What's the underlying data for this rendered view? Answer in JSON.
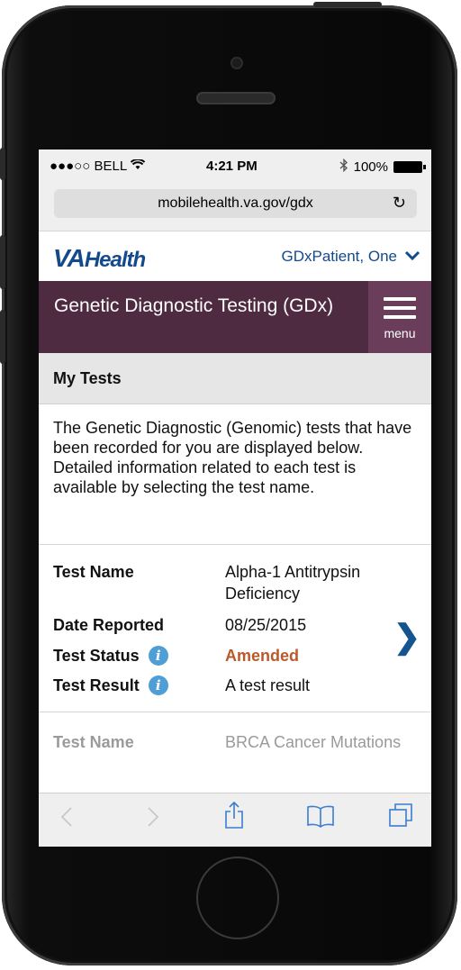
{
  "status": {
    "carrier": "●●●○○ BELL",
    "wifi_icon": "wifi-icon",
    "time": "4:21 PM",
    "bluetooth_icon": "bluetooth-icon",
    "battery_percent": "100%"
  },
  "browser": {
    "url": "mobilehealth.va.gov/gdx",
    "reload_icon": "reload-icon"
  },
  "header": {
    "logo_va": "VA",
    "logo_health": "Health",
    "user_name": "GDxPatient, One",
    "user_chevron_icon": "chevron-down-icon"
  },
  "app": {
    "title": "Genetic Diagnostic Testing (GDx)",
    "menu_label": "menu",
    "bar_color": "#4f2b41"
  },
  "section": {
    "title": "My Tests"
  },
  "intro": "The Genetic Diagnostic (Genomic) tests that have been recorded for you are displayed below.  Detailed information related to each test is available by selecting the test name.",
  "tests": [
    {
      "name_label": "Test Name",
      "name": "Alpha-1 Antitrypsin Deficiency",
      "date_label": "Date Reported",
      "date": "08/25/2015",
      "status_label": "Test Status",
      "status": "Amended",
      "result_label": "Test Result",
      "result": "A test result"
    },
    {
      "name_label": "Test Name",
      "name": "BRCA Cancer Mutations"
    }
  ],
  "toolbar": {
    "back_icon": "back-icon",
    "forward_icon": "forward-icon",
    "share_icon": "share-icon",
    "bookmarks_icon": "bookmarks-icon",
    "tabs_icon": "tabs-icon"
  }
}
